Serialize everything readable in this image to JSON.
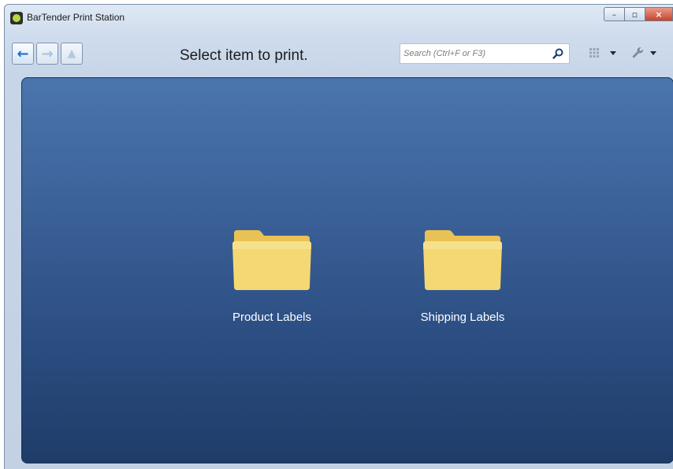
{
  "window": {
    "title": "BarTender Print Station",
    "controls": {
      "minimize": "–",
      "maximize": "▫",
      "close": "×"
    }
  },
  "toolbar": {
    "back_icon": "arrow-left-icon",
    "forward_icon": "arrow-right-icon",
    "up_icon": "arrow-up-icon",
    "prompt": "Select item to print.",
    "search": {
      "placeholder": "Search (Ctrl+F or F3)",
      "value": ""
    },
    "view_icon": "grid-view-icon",
    "tools_icon": "wrench-icon"
  },
  "content": {
    "items": [
      {
        "label": "Product Labels",
        "icon": "folder-icon"
      },
      {
        "label": "Shipping Labels",
        "icon": "folder-icon"
      }
    ]
  },
  "colors": {
    "panel_top": "#4b75ad",
    "panel_bottom": "#1f3c68",
    "folder": "#f2d36b",
    "back_arrow": "#1f6fd0",
    "close_button": "#c6462b"
  }
}
